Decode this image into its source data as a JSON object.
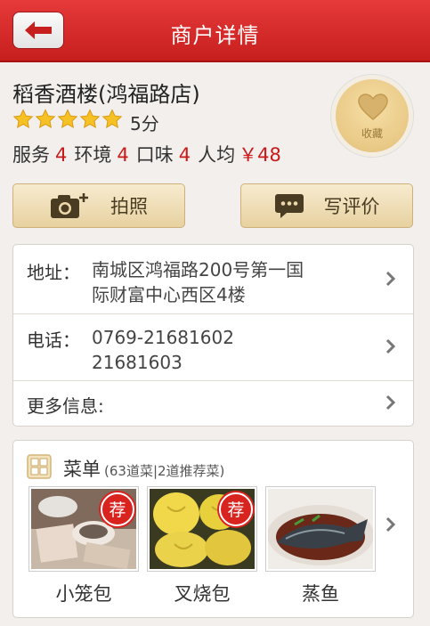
{
  "header": {
    "title": "商户详情",
    "back_icon": "back-arrow-icon"
  },
  "shop": {
    "name": "稻香酒楼(鸿福路店)",
    "rating_stars": 5,
    "score": "5分",
    "service_label": "服务",
    "service": "4",
    "environment_label": "环境",
    "environment": "4",
    "taste_label": "口味",
    "taste": "4",
    "avg_label": "人均",
    "avg_price": "￥48",
    "favorite_label": "收藏"
  },
  "actions": {
    "photo_label": "拍照",
    "review_label": "写评价"
  },
  "info": {
    "address_label": "地址：",
    "address_line1": "南城区鸿福路200号第一国",
    "address_line2": "际财富中心西区4楼",
    "phone_label": "电话：",
    "phone_line1": "0769-21681602",
    "phone_line2": "21681603",
    "more_label": "更多信息:"
  },
  "menu": {
    "title": "菜单",
    "subtitle": "(63道菜|2道推荐菜)",
    "recommend_badge": "荐",
    "dishes": [
      {
        "name": "小笼包",
        "recommended": true
      },
      {
        "name": "叉烧包",
        "recommended": true
      },
      {
        "name": "蒸鱼",
        "recommended": false
      }
    ]
  },
  "colors": {
    "header_red": "#d42a2a",
    "accent_red": "#c81a1a",
    "button_gold": "#ecd8ab"
  }
}
